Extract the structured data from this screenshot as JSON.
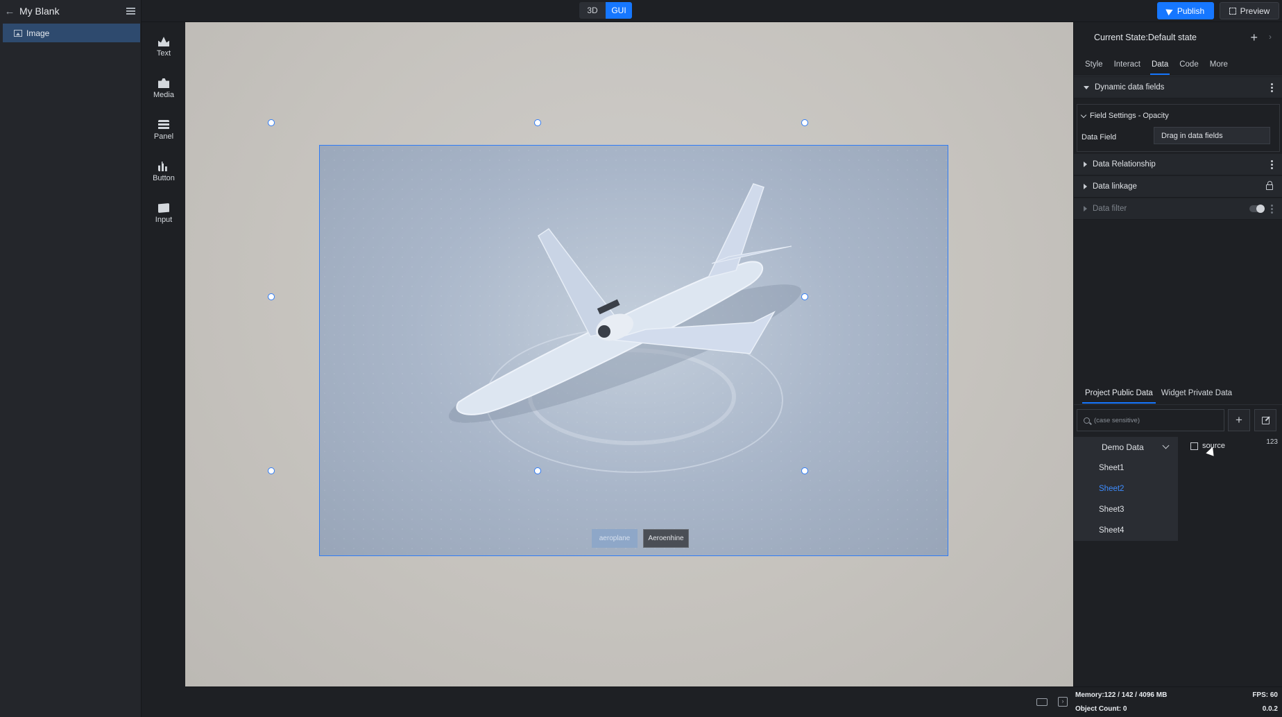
{
  "header": {
    "project_title": "My Blank",
    "mode_3d": "3D",
    "mode_gui": "GUI",
    "publish_label": "Publish",
    "preview_label": "Preview"
  },
  "layers": {
    "items": [
      {
        "label": "Image",
        "icon": "image-icon",
        "selected": true
      }
    ]
  },
  "widgets": [
    {
      "label": "Text",
      "icon": "crown-text-icon"
    },
    {
      "label": "Media",
      "icon": "media-icon"
    },
    {
      "label": "Panel",
      "icon": "panel-icon"
    },
    {
      "label": "Button",
      "icon": "bar-chart-icon"
    },
    {
      "label": "Input",
      "icon": "input-icon"
    }
  ],
  "canvas": {
    "buttons": [
      "aeroplane",
      "Aeroenhine"
    ],
    "selection_color": "#2f7cf6"
  },
  "right_panel": {
    "current_state": "Current State:Default state",
    "tabs": [
      "Style",
      "Interact",
      "Data",
      "Code",
      "More"
    ],
    "active_tab": "Data",
    "sections": {
      "dynamic_fields": "Dynamic data fields",
      "field_settings": "Field Settings - Opacity",
      "data_field_label": "Data Field",
      "data_field_placeholder": "Drag in data fields",
      "relationship": "Data Relationship",
      "linkage": "Data linkage",
      "filter": "Data filter"
    },
    "data_tabs": [
      "Project Public Data",
      "Widget Private Data"
    ],
    "search_placeholder": "(case sensitive)",
    "source_group": "Demo Data",
    "sheets": [
      "Sheet1",
      "Sheet2",
      "Sheet3",
      "Sheet4"
    ],
    "selected_sheet": "Sheet2",
    "field_name": "source",
    "field_type": "123"
  },
  "stats": {
    "memory": "Memory:122 / 142 / 4096 MB",
    "fps": "FPS: 60",
    "object_count": "Object Count: 0",
    "version": "0.0.2"
  },
  "colors": {
    "accent": "#1677ff",
    "selected_sheet": "#3d8cff"
  }
}
